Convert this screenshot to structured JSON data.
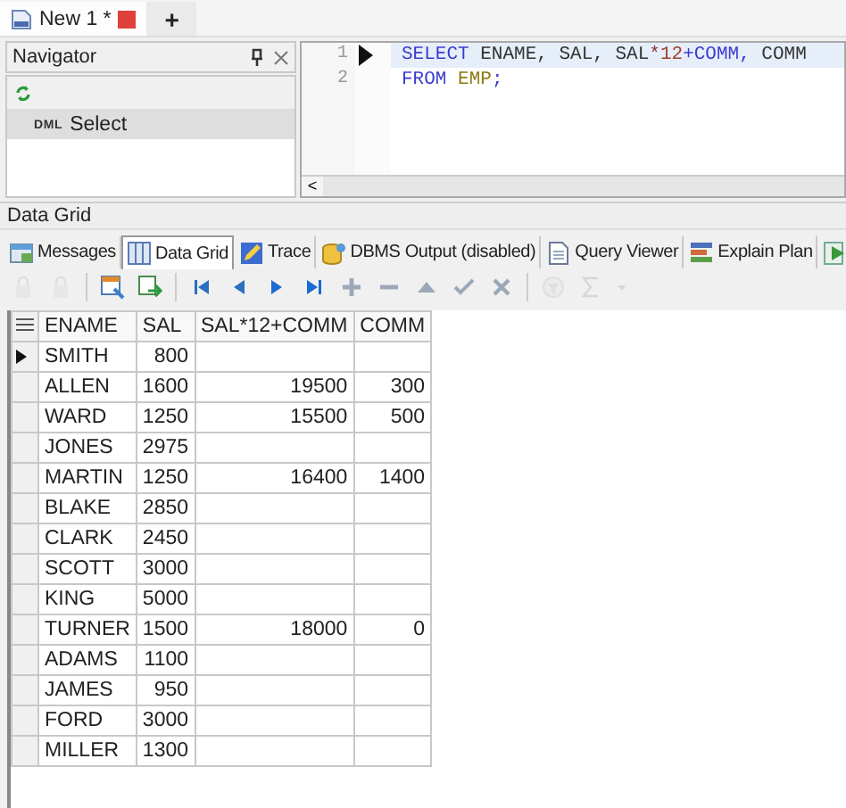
{
  "doc_tabs": [
    {
      "label": "New 1 *",
      "selected": true,
      "kind": "document"
    },
    {
      "label": "+",
      "selected": false,
      "kind": "add"
    }
  ],
  "navigator": {
    "title": "Navigator",
    "items": [
      {
        "badge": "DML",
        "label": "Select",
        "selected": true
      }
    ]
  },
  "editor": {
    "lines": [
      {
        "number": "1",
        "current": true,
        "tokens": [
          {
            "text": "SELECT",
            "kind": "keyword"
          },
          {
            "text": " ENAME, SAL, SAL",
            "kind": "plain"
          },
          {
            "text": "*",
            "kind": "operator"
          },
          {
            "text": "12",
            "kind": "number"
          },
          {
            "text": "+COMM,",
            "kind": "keyword"
          },
          {
            "text": " COMM",
            "kind": "plain"
          }
        ]
      },
      {
        "number": "2",
        "current": false,
        "tokens": [
          {
            "text": "FROM",
            "kind": "keyword"
          },
          {
            "text": " EMP",
            "kind": "table"
          },
          {
            "text": ";",
            "kind": "keyword"
          }
        ]
      }
    ],
    "scroll_left": "<"
  },
  "results_title": "Data Grid",
  "result_tabs": [
    {
      "label": "Messages",
      "kind": "messages",
      "selected": false
    },
    {
      "label": "Data Grid",
      "kind": "grid",
      "selected": true
    },
    {
      "label": "Trace",
      "kind": "trace",
      "selected": false
    },
    {
      "label": "DBMS Output (disabled)",
      "kind": "dbms",
      "selected": false
    },
    {
      "label": "Query Viewer",
      "kind": "page",
      "selected": false
    },
    {
      "label": "Explain Plan",
      "kind": "plan",
      "selected": false
    },
    {
      "kind": "run",
      "selected": false
    }
  ],
  "toolbar": [
    {
      "kind": "lock",
      "disabled": true
    },
    {
      "kind": "lock",
      "disabled": true
    },
    {
      "kind": "sep"
    },
    {
      "kind": "grid-edit",
      "disabled": false
    },
    {
      "kind": "export",
      "disabled": false
    },
    {
      "kind": "sep"
    },
    {
      "kind": "first",
      "disabled": false
    },
    {
      "kind": "prev",
      "disabled": false
    },
    {
      "kind": "next",
      "disabled": false
    },
    {
      "kind": "last",
      "disabled": false
    },
    {
      "kind": "plus",
      "disabled": false
    },
    {
      "kind": "minus",
      "disabled": false
    },
    {
      "kind": "up",
      "disabled": false
    },
    {
      "kind": "check",
      "disabled": false
    },
    {
      "kind": "cross",
      "disabled": false
    },
    {
      "kind": "sep"
    },
    {
      "kind": "filter",
      "disabled": true
    },
    {
      "kind": "sum",
      "disabled": true
    },
    {
      "kind": "caret",
      "disabled": true
    }
  ],
  "table": {
    "columns": [
      {
        "label": "ENAME"
      },
      {
        "label": "SAL"
      },
      {
        "label": "SAL*12+COMM"
      },
      {
        "label": "COMM"
      }
    ],
    "rows": [
      {
        "current": true,
        "cells": [
          "SMITH",
          "800",
          "",
          ""
        ]
      },
      {
        "current": false,
        "cells": [
          "ALLEN",
          "1600",
          "19500",
          "300"
        ]
      },
      {
        "current": false,
        "cells": [
          "WARD",
          "1250",
          "15500",
          "500"
        ]
      },
      {
        "current": false,
        "cells": [
          "JONES",
          "2975",
          "",
          ""
        ]
      },
      {
        "current": false,
        "cells": [
          "MARTIN",
          "1250",
          "16400",
          "1400"
        ]
      },
      {
        "current": false,
        "cells": [
          "BLAKE",
          "2850",
          "",
          ""
        ]
      },
      {
        "current": false,
        "cells": [
          "CLARK",
          "2450",
          "",
          ""
        ]
      },
      {
        "current": false,
        "cells": [
          "SCOTT",
          "3000",
          "",
          ""
        ]
      },
      {
        "current": false,
        "cells": [
          "KING",
          "5000",
          "",
          ""
        ]
      },
      {
        "current": false,
        "cells": [
          "TURNER",
          "1500",
          "18000",
          "0"
        ]
      },
      {
        "current": false,
        "cells": [
          "ADAMS",
          "1100",
          "",
          ""
        ]
      },
      {
        "current": false,
        "cells": [
          "JAMES",
          "950",
          "",
          ""
        ]
      },
      {
        "current": false,
        "cells": [
          "FORD",
          "3000",
          "",
          ""
        ]
      },
      {
        "current": false,
        "cells": [
          "MILLER",
          "1300",
          "",
          ""
        ]
      }
    ]
  }
}
